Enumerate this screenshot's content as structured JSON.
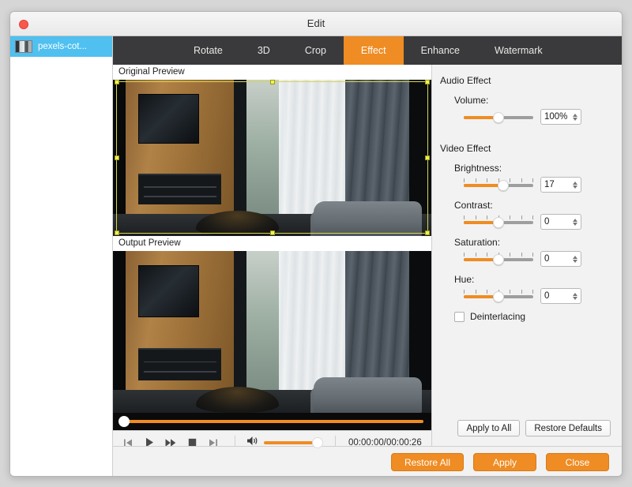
{
  "window": {
    "title": "Edit",
    "close_button": "close"
  },
  "sidebar": {
    "items": [
      {
        "label": "pexels-cot...",
        "thumb": "video-thumbnail"
      }
    ]
  },
  "tabs": [
    {
      "label": "Rotate",
      "active": false
    },
    {
      "label": "3D",
      "active": false
    },
    {
      "label": "Crop",
      "active": false
    },
    {
      "label": "Effect",
      "active": true
    },
    {
      "label": "Enhance",
      "active": false
    },
    {
      "label": "Watermark",
      "active": false
    }
  ],
  "preview": {
    "original_label": "Original Preview",
    "output_label": "Output Preview",
    "scrub_position_pct": 1
  },
  "player": {
    "prev_icon": "skip-previous-icon",
    "play_icon": "play-icon",
    "forward_icon": "fast-forward-icon",
    "stop_icon": "stop-icon",
    "next_icon": "skip-next-icon",
    "speaker_icon": "speaker-icon",
    "volume_pct": 100,
    "timecode": "00:00:00/00:00:26"
  },
  "settings": {
    "audio_group_title": "Audio Effect",
    "video_group_title": "Video Effect",
    "volume": {
      "label": "Volume:",
      "value": "100%",
      "knob_pct": 50,
      "ticks": false
    },
    "brightness": {
      "label": "Brightness:",
      "value": "17",
      "knob_pct": 57,
      "ticks": true
    },
    "contrast": {
      "label": "Contrast:",
      "value": "0",
      "knob_pct": 50,
      "ticks": true
    },
    "saturation": {
      "label": "Saturation:",
      "value": "0",
      "knob_pct": 50,
      "ticks": true
    },
    "hue": {
      "label": "Hue:",
      "value": "0",
      "knob_pct": 50,
      "ticks": true
    },
    "deinterlacing": {
      "label": "Deinterlacing",
      "checked": false
    },
    "apply_to_all": "Apply to All",
    "restore_defaults": "Restore Defaults"
  },
  "footer": {
    "restore_all": "Restore All",
    "apply": "Apply",
    "close": "Close"
  },
  "colors": {
    "accent": "#ef8c23",
    "tabbar": "#3a3a3c",
    "selection": "#4fc0f0",
    "crop_handle": "#f2f24e"
  }
}
